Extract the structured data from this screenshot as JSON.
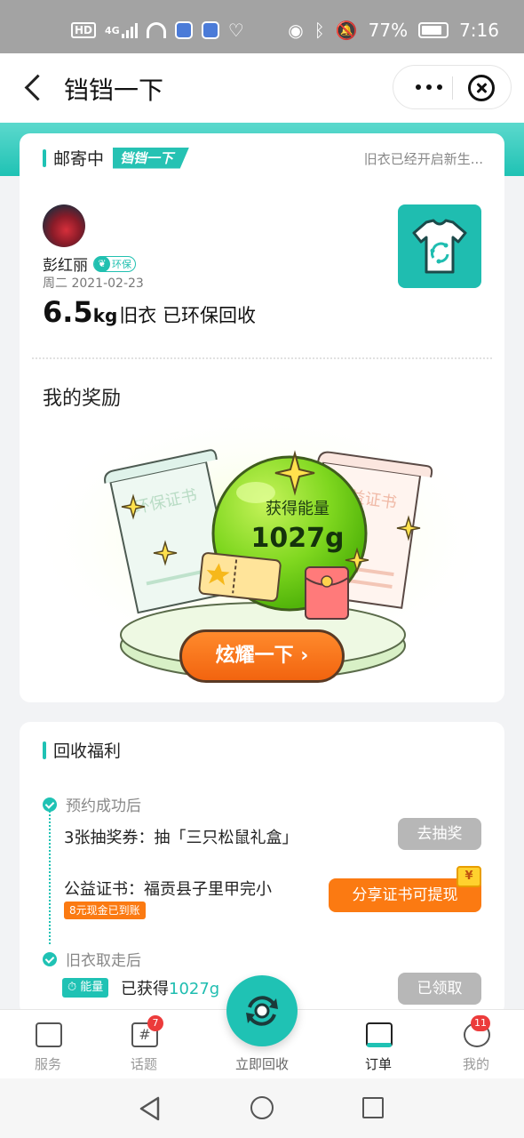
{
  "status_bar": {
    "network": "HD",
    "network_gen": "4G",
    "battery": "77%",
    "time": "7:16"
  },
  "title_bar": {
    "title": "铛铛一下"
  },
  "mail_card": {
    "section_label": "邮寄中",
    "brand_tag": "铛铛一下",
    "hint": "旧衣已经开启新生...",
    "username": "彭红丽",
    "eco_badge": "环保",
    "date": "周二 2021-02-23",
    "weight_value": "6.5",
    "weight_unit": "kg",
    "weight_desc": "旧衣 已环保回收"
  },
  "rewards": {
    "title": "我的奖励",
    "energy_label": "获得能量",
    "energy_value": "1027g",
    "left_certificate": "环保证书",
    "right_certificate": "公益证书",
    "share_button": "炫耀一下 ›"
  },
  "benefits": {
    "title": "回收福利",
    "step1_label": "预约成功后",
    "lottery_text": "3张抽奖券：抽「三只松鼠礼盒」",
    "lottery_button": "去抽奖",
    "cert_text": "公益证书：福贡县子里甲完小",
    "cash_tag": "8元现金已到账",
    "cert_button": "分享证书可提现",
    "money_icon": "¥",
    "step2_label": "旧衣取走后",
    "energy_chip": "能量",
    "obtained_prefix": "已获得",
    "obtained_value": "1027g",
    "claimed_button": "已领取"
  },
  "bottom_nav": {
    "service": "服务",
    "topics": "话题",
    "topics_badge": "7",
    "recycle": "立即回收",
    "orders": "订单",
    "mine": "我的",
    "mine_badge": "11"
  },
  "colors": {
    "accent": "#1fc2b4",
    "orange": "#fb7a12",
    "green_ball": "#7ed321"
  }
}
